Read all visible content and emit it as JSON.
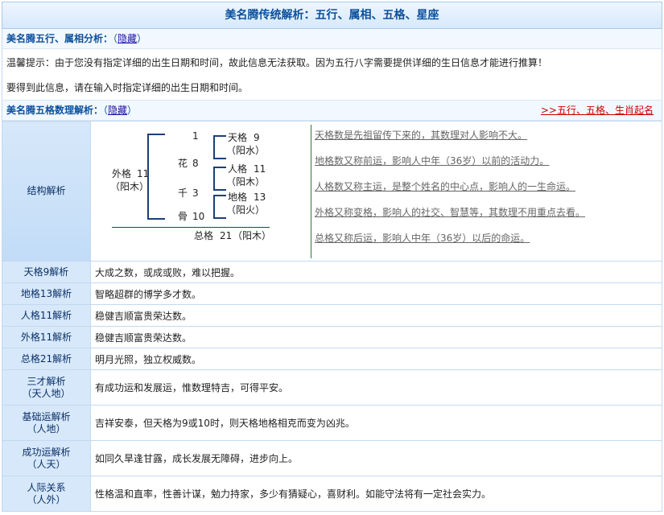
{
  "header": {
    "title": "美名腾传统解析：五行、属相、五格、星座"
  },
  "wuxing_section": {
    "title": "美名腾五行、属相分析：",
    "paren_open": "（",
    "toggle": "隐藏",
    "paren_close": "）",
    "tip1": "温馨提示：由于您没有指定详细的出生日期和时间，故此信息无法获取。因为五行八字需要提供详细的生日信息才能进行推算！",
    "tip2": "要得到此信息，请在输入时指定详细的出生日期和时间。"
  },
  "wuge_section": {
    "title": "美名腾五格数理解析：",
    "paren_open": "（",
    "toggle": "隐藏",
    "paren_close": "）",
    "right_link": ">>五行、五格、生肖起名"
  },
  "structure": {
    "label": "结构解析",
    "top_num": "1",
    "chars": [
      {
        "char": "花",
        "num": "8"
      },
      {
        "char": "千",
        "num": "3"
      },
      {
        "char": "骨",
        "num": "10"
      }
    ],
    "waige": {
      "name": "外格",
      "num": "11",
      "element": "（阳木）"
    },
    "tiange": {
      "name": "天格",
      "num": "9",
      "element": "（阳水）"
    },
    "renge": {
      "name": "人格",
      "num": "11",
      "element": "（阳木）"
    },
    "dige": {
      "name": "地格",
      "num": "13",
      "element": "（阳火）"
    },
    "zongge": {
      "name": "总格",
      "num": "21",
      "element": "（阳木）"
    },
    "notes": [
      "天格数是先祖留传下来的，其数理对人影响不大。",
      "地格数又称前运，影响人中年（36岁）以前的活动力。",
      "人格数又称主运，是整个姓名的中心点，影响人的一生命运。",
      "外格又称变格，影响人的社交、智慧等，其数理不用重点去看。",
      "总格又称后运，影响人中年（36岁）以后的命运。"
    ]
  },
  "rows": [
    {
      "label": "天格9解析",
      "sub": "",
      "value": "大成之数，或成或败，难以把握。"
    },
    {
      "label": "地格13解析",
      "sub": "",
      "value": "智略超群的博学多才数。"
    },
    {
      "label": "人格11解析",
      "sub": "",
      "value": "稳健吉顺富贵荣达数。"
    },
    {
      "label": "外格11解析",
      "sub": "",
      "value": "稳健吉顺富贵荣达数。"
    },
    {
      "label": "总格21解析",
      "sub": "",
      "value": "明月光照，独立权威数。"
    },
    {
      "label": "三才解析",
      "sub": "（天人地）",
      "value": "有成功运和发展运，惟数理特吉，可得平安。"
    },
    {
      "label": "基础运解析",
      "sub": "（人地）",
      "value": "吉祥安泰，但天格为9或10时，则天格地格相克而变为凶兆。"
    },
    {
      "label": "成功运解析",
      "sub": "（人天）",
      "value": "如同久旱逢甘露，成长发展无障碍，进步向上。"
    },
    {
      "label": "人际关系",
      "sub": "（人外）",
      "value": "性格温和直率，性善计谋，勉力持家，多少有猜疑心，喜财利。如能守法将有一定社会实力。"
    }
  ]
}
